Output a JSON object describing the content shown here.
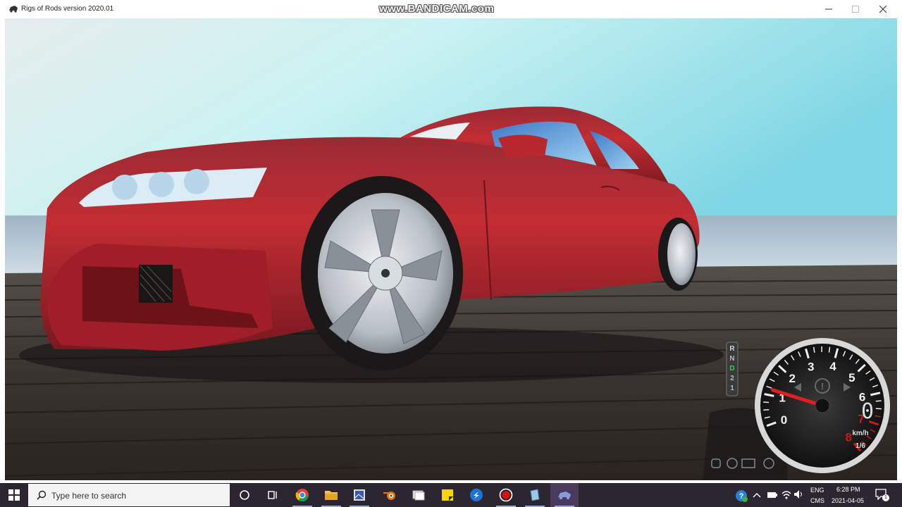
{
  "window": {
    "title": "Rigs of Rods version 2020.01",
    "watermark": "www.BANDICAM.com",
    "controls": [
      "minimize",
      "maximize",
      "close"
    ]
  },
  "hud": {
    "tachometer": {
      "ticks": [
        "0",
        "1",
        "2",
        "3",
        "4",
        "5",
        "6",
        "7",
        "8"
      ],
      "redline_ticks": [
        "7",
        "8"
      ],
      "needle_value": 1.2
    },
    "speed_digit": "0",
    "speed_unit": "km/h",
    "gear_readout": "1/6",
    "shifter": {
      "positions": [
        "R",
        "N",
        "D",
        "2",
        "1"
      ],
      "active": "D"
    }
  },
  "taskbar": {
    "search_placeholder": "Type here to search",
    "apps": [
      "cortana-icon",
      "task-view-icon",
      "chrome-icon",
      "file-explorer-icon",
      "image-viewer-icon",
      "blender-icon",
      "gallery-icon",
      "sticky-notes-icon",
      "vpn-icon",
      "bandicam-icon",
      "notepad-icon",
      "rigs-of-rods-icon"
    ],
    "tray": {
      "lang_line1": "ENG",
      "lang_line2": "CMS",
      "time": "6:28 PM",
      "date": "2021-04-05",
      "notification_count": "1"
    }
  },
  "colors": {
    "car_body": "#a8232c",
    "sky": "#b6e8ee",
    "deck": "#3a3532",
    "redline": "#d01818",
    "taskbar": "#2b2630"
  }
}
